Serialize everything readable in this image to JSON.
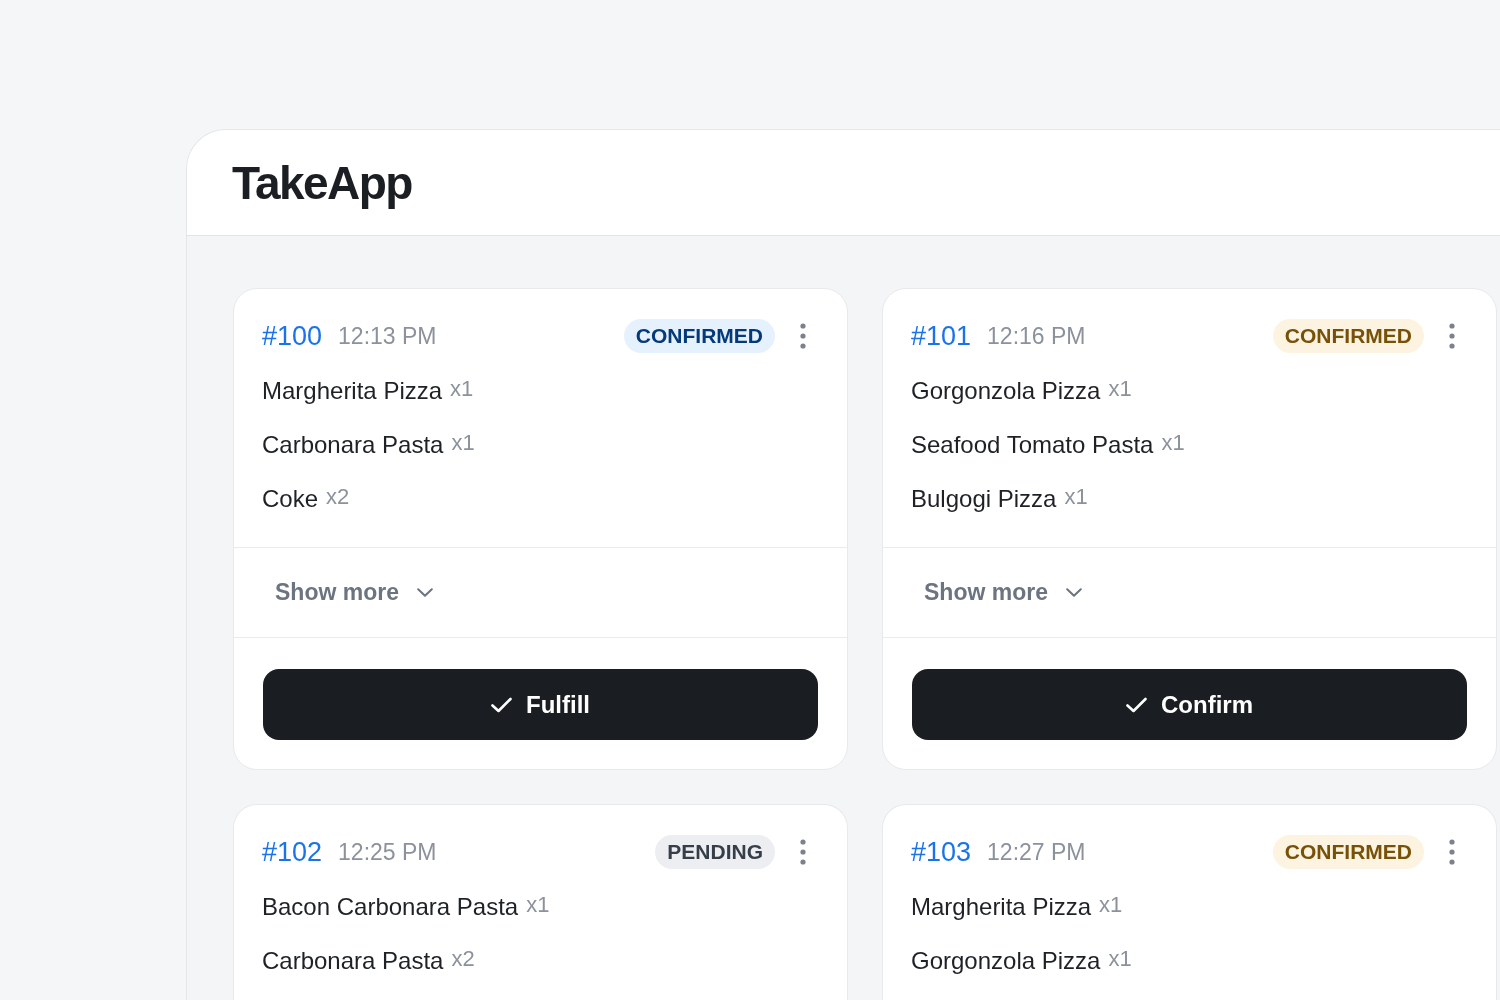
{
  "app": {
    "logo": "TakeApp"
  },
  "orders": [
    {
      "number": "#100",
      "time": "12:13 PM",
      "status": {
        "label": "CONFIRMED",
        "color": "#e6f1fe"
      },
      "items": [
        {
          "name": "Margherita Pizza",
          "quantity": "x1"
        },
        {
          "name": "Carbonara Pasta",
          "quantity": "x1"
        },
        {
          "name": "Coke",
          "quantity": "x2"
        }
      ],
      "show_more": "Show more",
      "action": "Fulfill"
    },
    {
      "number": "#101",
      "time": "12:16 PM",
      "status": {
        "label": "CONFIRMED",
        "color": "#fdf3e1"
      },
      "items": [
        {
          "name": "Gorgonzola Pizza",
          "quantity": "x1"
        },
        {
          "name": "Seafood Tomato Pasta",
          "quantity": "x1"
        },
        {
          "name": "Bulgogi Pizza",
          "quantity": "x1"
        }
      ],
      "show_more": "Show more",
      "action": "Confirm"
    },
    {
      "number": "#102",
      "time": "12:25 PM",
      "status": {
        "label": "PENDING",
        "color": "#eceef1"
      },
      "items": [
        {
          "name": "Bacon Carbonara Pasta",
          "quantity": "x1"
        },
        {
          "name": "Carbonara Pasta",
          "quantity": "x2"
        }
      ]
    },
    {
      "number": "#103",
      "time": "12:27 PM",
      "status": {
        "label": "CONFIRMED",
        "color": "#fdf3e1"
      },
      "items": [
        {
          "name": "Margherita Pizza",
          "quantity": "x1"
        },
        {
          "name": "Gorgonzola Pizza",
          "quantity": "x1"
        }
      ]
    }
  ]
}
